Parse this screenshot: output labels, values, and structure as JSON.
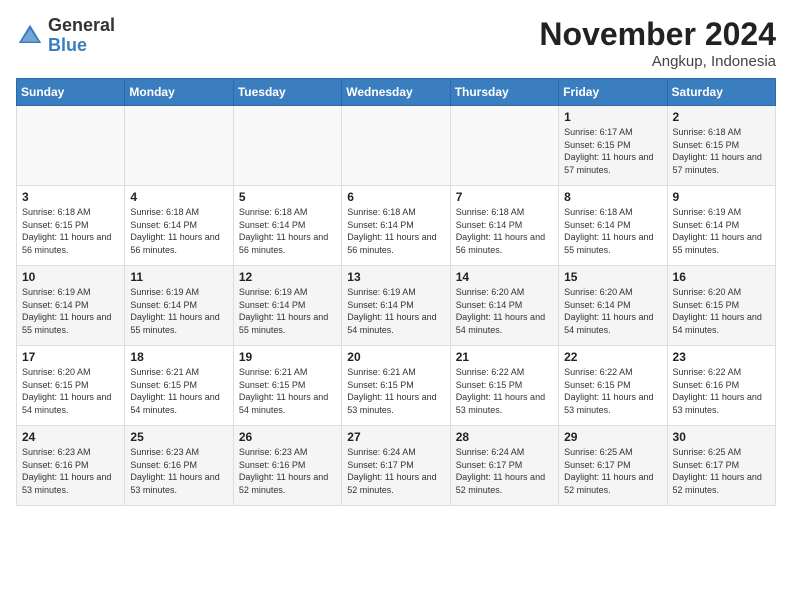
{
  "header": {
    "logo_line1": "General",
    "logo_line2": "Blue",
    "month": "November 2024",
    "location": "Angkup, Indonesia"
  },
  "days_of_week": [
    "Sunday",
    "Monday",
    "Tuesday",
    "Wednesday",
    "Thursday",
    "Friday",
    "Saturday"
  ],
  "weeks": [
    [
      {
        "day": "",
        "info": ""
      },
      {
        "day": "",
        "info": ""
      },
      {
        "day": "",
        "info": ""
      },
      {
        "day": "",
        "info": ""
      },
      {
        "day": "",
        "info": ""
      },
      {
        "day": "1",
        "info": "Sunrise: 6:17 AM\nSunset: 6:15 PM\nDaylight: 11 hours and 57 minutes."
      },
      {
        "day": "2",
        "info": "Sunrise: 6:18 AM\nSunset: 6:15 PM\nDaylight: 11 hours and 57 minutes."
      }
    ],
    [
      {
        "day": "3",
        "info": "Sunrise: 6:18 AM\nSunset: 6:15 PM\nDaylight: 11 hours and 56 minutes."
      },
      {
        "day": "4",
        "info": "Sunrise: 6:18 AM\nSunset: 6:14 PM\nDaylight: 11 hours and 56 minutes."
      },
      {
        "day": "5",
        "info": "Sunrise: 6:18 AM\nSunset: 6:14 PM\nDaylight: 11 hours and 56 minutes."
      },
      {
        "day": "6",
        "info": "Sunrise: 6:18 AM\nSunset: 6:14 PM\nDaylight: 11 hours and 56 minutes."
      },
      {
        "day": "7",
        "info": "Sunrise: 6:18 AM\nSunset: 6:14 PM\nDaylight: 11 hours and 56 minutes."
      },
      {
        "day": "8",
        "info": "Sunrise: 6:18 AM\nSunset: 6:14 PM\nDaylight: 11 hours and 55 minutes."
      },
      {
        "day": "9",
        "info": "Sunrise: 6:19 AM\nSunset: 6:14 PM\nDaylight: 11 hours and 55 minutes."
      }
    ],
    [
      {
        "day": "10",
        "info": "Sunrise: 6:19 AM\nSunset: 6:14 PM\nDaylight: 11 hours and 55 minutes."
      },
      {
        "day": "11",
        "info": "Sunrise: 6:19 AM\nSunset: 6:14 PM\nDaylight: 11 hours and 55 minutes."
      },
      {
        "day": "12",
        "info": "Sunrise: 6:19 AM\nSunset: 6:14 PM\nDaylight: 11 hours and 55 minutes."
      },
      {
        "day": "13",
        "info": "Sunrise: 6:19 AM\nSunset: 6:14 PM\nDaylight: 11 hours and 54 minutes."
      },
      {
        "day": "14",
        "info": "Sunrise: 6:20 AM\nSunset: 6:14 PM\nDaylight: 11 hours and 54 minutes."
      },
      {
        "day": "15",
        "info": "Sunrise: 6:20 AM\nSunset: 6:14 PM\nDaylight: 11 hours and 54 minutes."
      },
      {
        "day": "16",
        "info": "Sunrise: 6:20 AM\nSunset: 6:15 PM\nDaylight: 11 hours and 54 minutes."
      }
    ],
    [
      {
        "day": "17",
        "info": "Sunrise: 6:20 AM\nSunset: 6:15 PM\nDaylight: 11 hours and 54 minutes."
      },
      {
        "day": "18",
        "info": "Sunrise: 6:21 AM\nSunset: 6:15 PM\nDaylight: 11 hours and 54 minutes."
      },
      {
        "day": "19",
        "info": "Sunrise: 6:21 AM\nSunset: 6:15 PM\nDaylight: 11 hours and 54 minutes."
      },
      {
        "day": "20",
        "info": "Sunrise: 6:21 AM\nSunset: 6:15 PM\nDaylight: 11 hours and 53 minutes."
      },
      {
        "day": "21",
        "info": "Sunrise: 6:22 AM\nSunset: 6:15 PM\nDaylight: 11 hours and 53 minutes."
      },
      {
        "day": "22",
        "info": "Sunrise: 6:22 AM\nSunset: 6:15 PM\nDaylight: 11 hours and 53 minutes."
      },
      {
        "day": "23",
        "info": "Sunrise: 6:22 AM\nSunset: 6:16 PM\nDaylight: 11 hours and 53 minutes."
      }
    ],
    [
      {
        "day": "24",
        "info": "Sunrise: 6:23 AM\nSunset: 6:16 PM\nDaylight: 11 hours and 53 minutes."
      },
      {
        "day": "25",
        "info": "Sunrise: 6:23 AM\nSunset: 6:16 PM\nDaylight: 11 hours and 53 minutes."
      },
      {
        "day": "26",
        "info": "Sunrise: 6:23 AM\nSunset: 6:16 PM\nDaylight: 11 hours and 52 minutes."
      },
      {
        "day": "27",
        "info": "Sunrise: 6:24 AM\nSunset: 6:17 PM\nDaylight: 11 hours and 52 minutes."
      },
      {
        "day": "28",
        "info": "Sunrise: 6:24 AM\nSunset: 6:17 PM\nDaylight: 11 hours and 52 minutes."
      },
      {
        "day": "29",
        "info": "Sunrise: 6:25 AM\nSunset: 6:17 PM\nDaylight: 11 hours and 52 minutes."
      },
      {
        "day": "30",
        "info": "Sunrise: 6:25 AM\nSunset: 6:17 PM\nDaylight: 11 hours and 52 minutes."
      }
    ]
  ]
}
